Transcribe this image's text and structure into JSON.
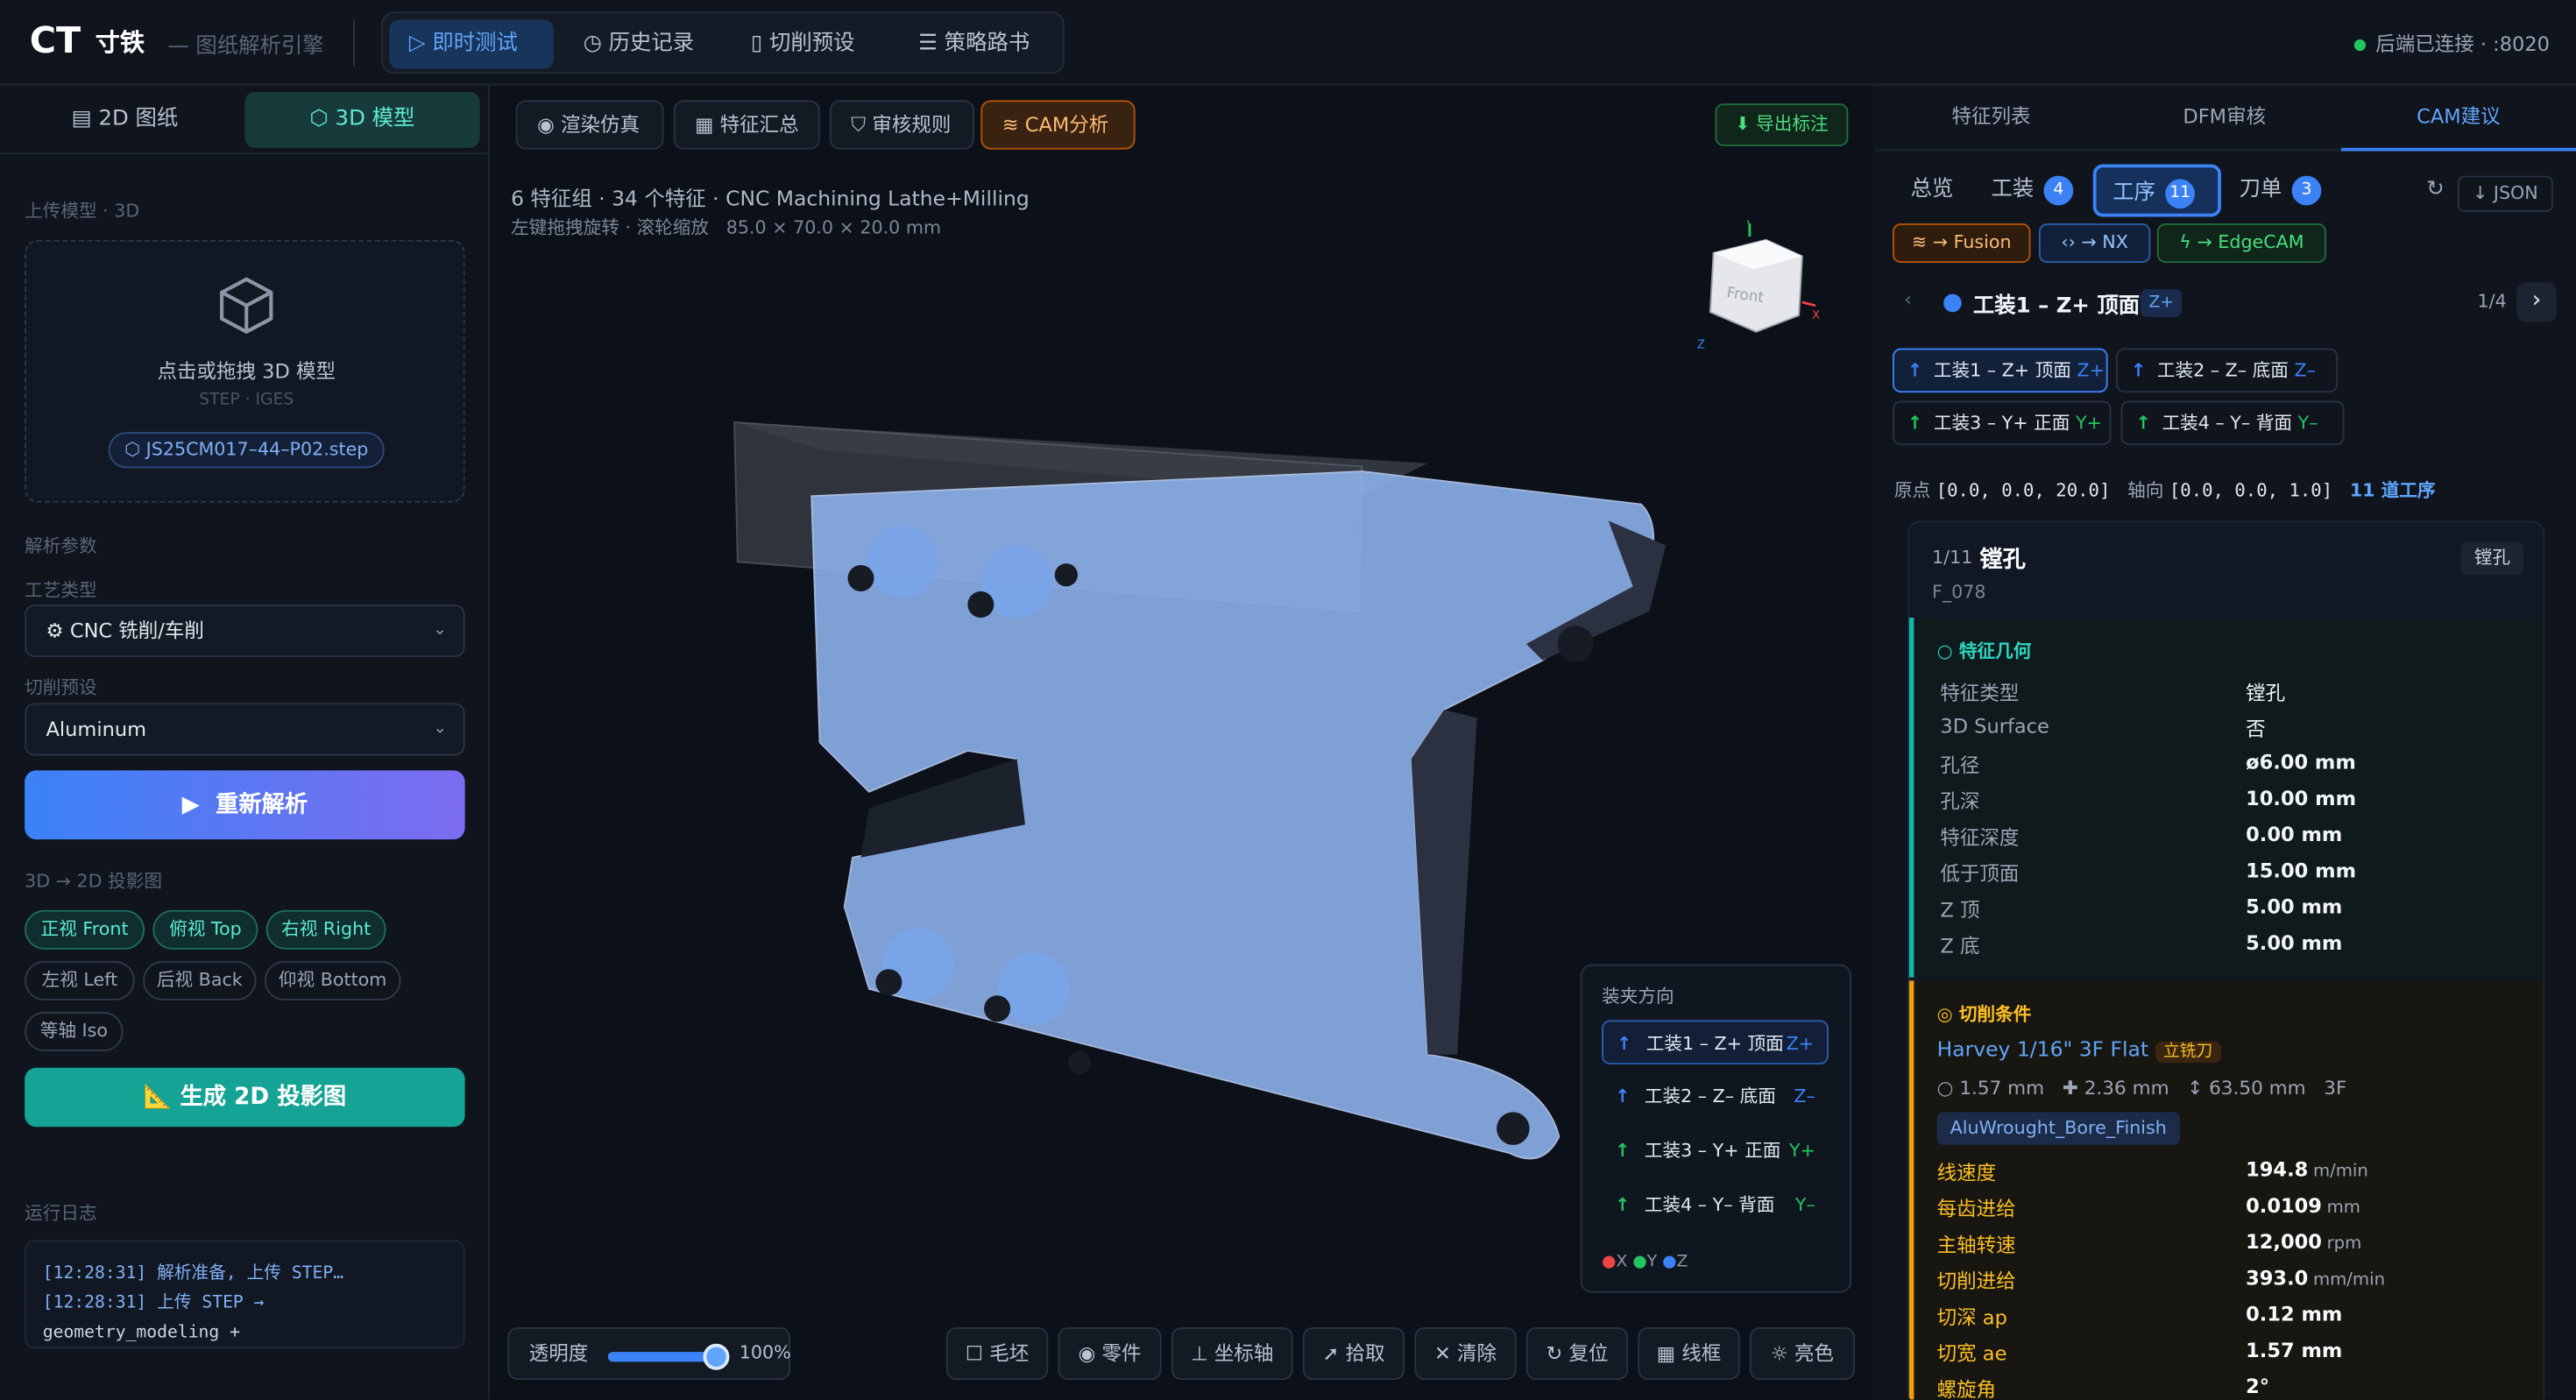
{
  "app": {
    "logo": "CT",
    "name": "寸铁",
    "subtitle": "— 图纸解析引擎",
    "status": "后端已连接 · :8020"
  },
  "nav": [
    {
      "label": "即时测试",
      "icon": "▷"
    },
    {
      "label": "历史记录",
      "icon": "◷"
    },
    {
      "label": "切削预设",
      "icon": "▯"
    },
    {
      "label": "策略路书",
      "icon": "☰"
    }
  ],
  "left": {
    "tabs": [
      {
        "label": "2D 图纸",
        "icon": "▤"
      },
      {
        "label": "3D 模型",
        "icon": "⬡"
      }
    ],
    "upload_title": "上传模型 · 3D",
    "drop_text": "点击或拖拽 3D 模型",
    "drop_formats": "STEP · IGES",
    "file_name": "JS25CM017–44–P02.step",
    "params_title": "解析参数",
    "process_label": "工艺类型",
    "process_value": "CNC 铣削/车削",
    "preset_label": "切削预设",
    "preset_value": "Aluminum",
    "reparse_label": "重新解析",
    "proj_title": "3D → 2D 投影图",
    "views": [
      "正视 Front",
      "俯视 Top",
      "右视 Right",
      "左视 Left",
      "后视 Back",
      "仰视 Bottom",
      "等轴 Iso"
    ],
    "gen_label": "生成 2D 投影图",
    "log_title": "运行日志",
    "log_lines": [
      "[12:28:31] 解析准备, 上传 STEP…",
      "[12:28:31] 上传 STEP →",
      "geometry_modeling +"
    ]
  },
  "viewer": {
    "tools": [
      {
        "label": "渲染仿真",
        "icon": "◉"
      },
      {
        "label": "特征汇总",
        "icon": "▦"
      },
      {
        "label": "审核规则",
        "icon": "⛉"
      },
      {
        "label": "CAM分析",
        "icon": "≋"
      }
    ],
    "export_label": "导出标注",
    "info_line1": "6 特征组 · 34 个特征 · CNC Machining Lathe+Milling",
    "info_hint": "左键拖拽旋转 · 滚轮缩放",
    "dims": "85.0 × 70.0 × 20.0 mm",
    "gizmo_face": "Front",
    "gizmo_x": "X",
    "gizmo_y": "Y",
    "gizmo_z": "Z",
    "fix_title": "装夹方向",
    "fixtures": [
      {
        "label": "工装1 – Z+ 顶面",
        "axis": "Z+",
        "color": "#3b82f6"
      },
      {
        "label": "工装2 – Z– 底面",
        "axis": "Z–",
        "color": "#3b82f6"
      },
      {
        "label": "工装3 – Y+ 正面",
        "axis": "Y+",
        "color": "#22c55e"
      },
      {
        "label": "工装4 – Y– 背面",
        "axis": "Y–",
        "color": "#22c55e"
      }
    ],
    "legend": {
      "x": "X",
      "y": "Y",
      "z": "Z"
    },
    "opacity_label": "透明度",
    "opacity_value": "100%",
    "opacity_level": 1.0,
    "bottom_tools": [
      {
        "label": "毛坯",
        "icon": "☐"
      },
      {
        "label": "零件",
        "icon": "◉"
      },
      {
        "label": "坐标轴",
        "icon": "⊥"
      },
      {
        "label": "拾取",
        "icon": "➚"
      },
      {
        "label": "清除",
        "icon": "✕"
      },
      {
        "label": "复位",
        "icon": "↻"
      },
      {
        "label": "线框",
        "icon": "▦"
      },
      {
        "label": "亮色",
        "icon": "☼"
      }
    ]
  },
  "right": {
    "tabs": [
      "特征列表",
      "DFM审核",
      "CAM建议"
    ],
    "subtabs": [
      {
        "label": "总览"
      },
      {
        "label": "工装",
        "count": "4"
      },
      {
        "label": "工序",
        "count": "11"
      },
      {
        "label": "刀单",
        "count": "3"
      }
    ],
    "json_label": "↓ JSON",
    "exports": [
      "→ Fusion",
      "→ NX",
      "→ EdgeCAM"
    ],
    "current_fixture": "工装1 – Z+ 顶面",
    "current_axis": "Z+",
    "pager": "1/4",
    "fixture_buttons": [
      {
        "label": "工装1 – Z+ 顶面",
        "axis": "Z+"
      },
      {
        "label": "工装2 – Z– 底面",
        "axis": "Z–"
      },
      {
        "label": "工装3 – Y+ 正面",
        "axis": "Y+"
      },
      {
        "label": "工装4 – Y– 背面",
        "axis": "Y–"
      }
    ],
    "origin_label": "原点",
    "origin_value": "[0.0, 0.0, 20.0]",
    "axis_label": "轴向",
    "axis_value": "[0.0, 0.0, 1.0]",
    "op_count": "11 道工序",
    "op": {
      "index": "1/11",
      "name": "镗孔",
      "feature_id": "F_078",
      "badge": "镗孔",
      "geo_title": "特征几何",
      "geo": [
        {
          "k": "特征类型",
          "v": "镗孔"
        },
        {
          "k": "3D Surface",
          "v": "否"
        },
        {
          "k": "孔径",
          "v": "ø6.00 mm"
        },
        {
          "k": "孔深",
          "v": "10.00 mm"
        },
        {
          "k": "特征深度",
          "v": "0.00 mm"
        },
        {
          "k": "低于顶面",
          "v": "15.00 mm"
        },
        {
          "k": "Z 顶",
          "v": "5.00 mm"
        },
        {
          "k": "Z 底",
          "v": "5.00 mm"
        }
      ],
      "cut_title": "切削条件",
      "tool_name": "Harvey 1/16\" 3F Flat",
      "tool_type": "立铣刀",
      "tool_dia": "1.57 mm",
      "tool_shank": "2.36 mm",
      "tool_len": "63.50 mm",
      "tool_flutes": "3F",
      "strategy": "AluWrought_Bore_Finish",
      "cut": [
        {
          "k": "线速度",
          "v": "194.8",
          "u": "m/min"
        },
        {
          "k": "每齿进给",
          "v": "0.0109",
          "u": "mm"
        },
        {
          "k": "主轴转速",
          "v": "12,000",
          "u": "rpm"
        },
        {
          "k": "切削进给",
          "v": "393.0",
          "u": "mm/min"
        },
        {
          "k": "切深 ap",
          "v": "0.12 mm",
          "u": ""
        },
        {
          "k": "切宽 ae",
          "v": "1.57 mm",
          "u": ""
        },
        {
          "k": "螺旋角",
          "v": "2°",
          "u": ""
        }
      ]
    }
  }
}
